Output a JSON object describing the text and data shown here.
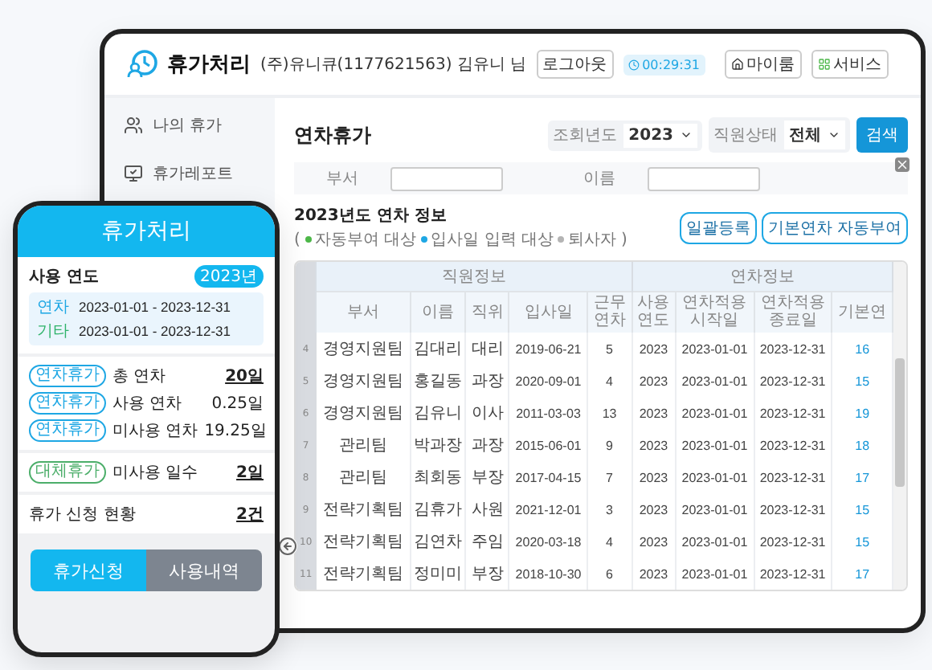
{
  "desktop": {
    "logo": "휴가처리",
    "account": "(주)유니큐(1177621563) 김유니 님",
    "logout": "로그아웃",
    "timer": "00:29:31",
    "header_links": [
      {
        "kind": "home",
        "label": "마이룸"
      },
      {
        "kind": "grid",
        "label": "서비스"
      }
    ],
    "sidebar": [
      {
        "kind": "people",
        "label": "나의 휴가"
      },
      {
        "kind": "report",
        "label": "휴가레포트"
      }
    ],
    "page_title": "연차휴가",
    "filters": [
      {
        "label": "조회년도",
        "value": "2023"
      },
      {
        "label": "직원상태",
        "value": "전체"
      }
    ],
    "search_button": "검색",
    "search_fields": [
      {
        "label": "부서"
      },
      {
        "label": "이름"
      }
    ],
    "section_title": "2023년도 연차 정보",
    "legend_open": "(",
    "legend_close": ")",
    "legend": [
      {
        "label": "자동부여 대상",
        "color": "#4cb748"
      },
      {
        "label": "입사일 입력 대상",
        "color": "#1ea7e4"
      },
      {
        "label": "퇴사자",
        "color": "#b4b4b4"
      }
    ],
    "actions": [
      "일괄등록",
      "기본연차 자동부여"
    ],
    "table": {
      "groups": [
        {
          "label": "직원정보",
          "columns": [
            "부서",
            "이름",
            "직위",
            "입사일",
            "근무연차"
          ]
        },
        {
          "label": "연차정보",
          "columns": [
            "사용연도",
            "연차적용시작일",
            "연차적용종료일",
            "기본연"
          ]
        }
      ],
      "rows": [
        {
          "number": "4",
          "cells": [
            "경영지원팀",
            "김대리",
            "대리",
            "2019-06-21",
            "5",
            "2023",
            "2023-01-01",
            "2023-12-31",
            "16"
          ]
        },
        {
          "number": "5",
          "cells": [
            "경영지원팀",
            "홍길동",
            "과장",
            "2020-09-01",
            "4",
            "2023",
            "2023-01-01",
            "2023-12-31",
            "15"
          ]
        },
        {
          "number": "6",
          "cells": [
            "경영지원팀",
            "김유니",
            "이사",
            "2011-03-03",
            "13",
            "2023",
            "2023-01-01",
            "2023-12-31",
            "19"
          ]
        },
        {
          "number": "7",
          "cells": [
            "관리팀",
            "박과장",
            "과장",
            "2015-06-01",
            "9",
            "2023",
            "2023-01-01",
            "2023-12-31",
            "18"
          ]
        },
        {
          "number": "8",
          "cells": [
            "관리팀",
            "최회동",
            "부장",
            "2017-04-15",
            "7",
            "2023",
            "2023-01-01",
            "2023-12-31",
            "17"
          ]
        },
        {
          "number": "9",
          "cells": [
            "전략기획팀",
            "김휴가",
            "사원",
            "2021-12-01",
            "3",
            "2023",
            "2023-01-01",
            "2023-12-31",
            "15"
          ]
        },
        {
          "number": "10",
          "cells": [
            "전략기획팀",
            "김연차",
            "주임",
            "2020-03-18",
            "4",
            "2023",
            "2023-01-01",
            "2023-12-31",
            "15"
          ]
        },
        {
          "number": "11",
          "cells": [
            "전략기획팀",
            "정미미",
            "부장",
            "2018-10-30",
            "6",
            "2023",
            "2023-01-01",
            "2023-12-31",
            "17"
          ]
        }
      ]
    }
  },
  "phone": {
    "title": "휴가처리",
    "year_label": "사용 연도",
    "year_badge": "2023년",
    "periods": [
      {
        "label": "연차",
        "value": "2023-01-01 - 2023-12-31",
        "color": "#1ea7e4"
      },
      {
        "label": "기타",
        "value": "2023-01-01 - 2023-12-31",
        "color": "#2fb36a"
      }
    ],
    "groups": [
      [
        {
          "tag": "연차휴가",
          "color": "#1ea7e4",
          "label": "총 연차",
          "value": "20일",
          "link": true
        },
        {
          "tag": "연차휴가",
          "color": "#1ea7e4",
          "label": "사용 연차",
          "value": "0.25일",
          "link": false
        },
        {
          "tag": "연차휴가",
          "color": "#1ea7e4",
          "label": "미사용 연차",
          "value": "19.25일",
          "link": false
        }
      ],
      [
        {
          "tag": "대체휴가",
          "color": "#4cae6a",
          "label": "미사용 일수",
          "value": "2일",
          "link": true
        }
      ],
      [
        {
          "label": "휴가 신청 현황",
          "value": "2건",
          "link": true
        }
      ]
    ],
    "buttons": [
      {
        "label": "휴가신청",
        "selected": true
      },
      {
        "label": "사용내역",
        "selected": false
      }
    ]
  }
}
